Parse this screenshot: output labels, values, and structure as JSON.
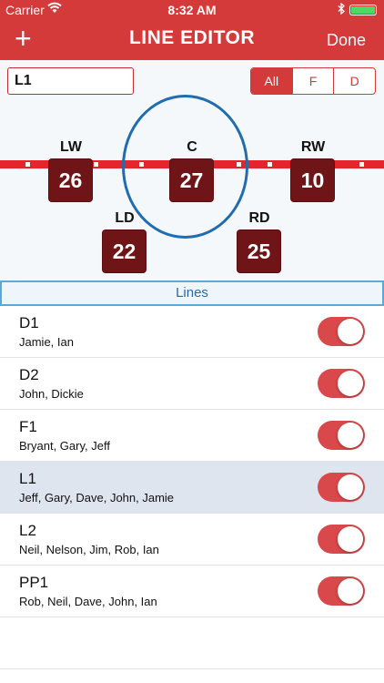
{
  "status": {
    "carrier": "Carrier",
    "time": "8:32 AM"
  },
  "navbar": {
    "add_label": "+",
    "title": "LINE EDITOR",
    "done_label": "Done"
  },
  "editor": {
    "line_name": "L1"
  },
  "filter": {
    "options": [
      "All",
      "F",
      "D"
    ],
    "selected": "All"
  },
  "positions": {
    "lw": {
      "label": "LW",
      "number": "26"
    },
    "c": {
      "label": "C",
      "number": "27"
    },
    "rw": {
      "label": "RW",
      "number": "10"
    },
    "ld": {
      "label": "LD",
      "number": "22"
    },
    "rd": {
      "label": "RD",
      "number": "25"
    }
  },
  "lines_header": "Lines",
  "lines": [
    {
      "name": "D1",
      "players": "Jamie, Ian",
      "enabled": true,
      "selected": false
    },
    {
      "name": "D2",
      "players": "John, Dickie",
      "enabled": true,
      "selected": false
    },
    {
      "name": "F1",
      "players": "Bryant, Gary, Jeff",
      "enabled": true,
      "selected": false
    },
    {
      "name": "L1",
      "players": "Jeff, Gary, Dave, John, Jamie",
      "enabled": true,
      "selected": true
    },
    {
      "name": "L2",
      "players": "Neil, Nelson, Jim, Rob, Ian",
      "enabled": true,
      "selected": false
    },
    {
      "name": "PP1",
      "players": "Rob, Neil, Dave, John, Ian",
      "enabled": true,
      "selected": false
    }
  ],
  "colors": {
    "brand": "#d53a3a",
    "jersey": "#6f1417",
    "circle": "#1f6db0",
    "toggle_on": "#d9484a"
  }
}
